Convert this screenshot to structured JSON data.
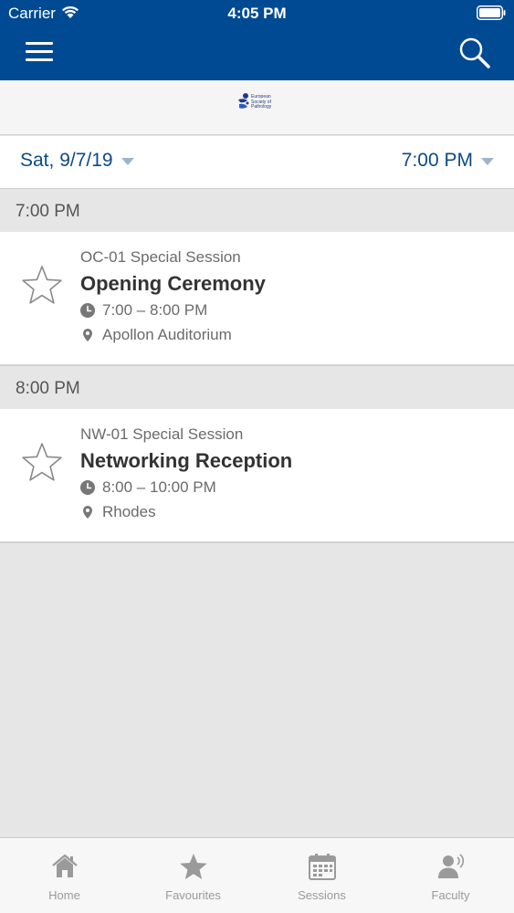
{
  "status_bar": {
    "carrier": "Carrier",
    "time": "4:05 PM"
  },
  "navbar": {
    "menu_icon": "hamburger-menu-icon",
    "search_icon": "search-icon"
  },
  "logo": {
    "text": "European\nSociety of\nPathology"
  },
  "filters": {
    "date": "Sat, 9/7/19",
    "time": "7:00 PM"
  },
  "sections": [
    {
      "header": "7:00 PM",
      "session": {
        "code": "OC-01 Special Session",
        "title": "Opening Ceremony",
        "time": "7:00 – 8:00 PM",
        "location": "Apollon Auditorium"
      }
    },
    {
      "header": "8:00 PM",
      "session": {
        "code": "NW-01 Special Session",
        "title": "Networking Reception",
        "time": "8:00 – 10:00 PM",
        "location": "Rhodes"
      }
    }
  ],
  "tabs": [
    {
      "label": "Home",
      "icon": "home-icon"
    },
    {
      "label": "Favourites",
      "icon": "star-icon"
    },
    {
      "label": "Sessions",
      "icon": "calendar-icon"
    },
    {
      "label": "Faculty",
      "icon": "speaker-icon"
    }
  ],
  "colors": {
    "brand": "#004a93",
    "link": "#0c4a86",
    "background": "#e6e6e6"
  }
}
